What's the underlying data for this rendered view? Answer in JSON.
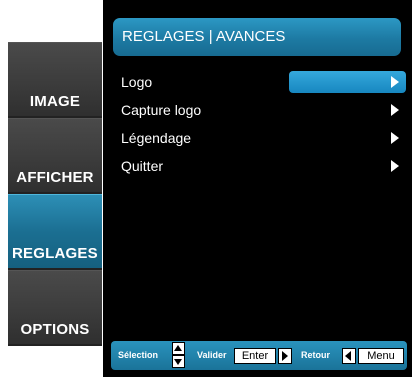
{
  "tabs": [
    {
      "label": "IMAGE",
      "active": false
    },
    {
      "label": "AFFICHER",
      "active": false
    },
    {
      "label": "REGLAGES",
      "active": true
    },
    {
      "label": "OPTIONS",
      "active": false
    }
  ],
  "panel": {
    "title": "REGLAGES | AVANCES",
    "items": [
      {
        "label": "Logo",
        "selected": true
      },
      {
        "label": "Capture logo",
        "selected": false
      },
      {
        "label": "Légendage",
        "selected": false
      },
      {
        "label": "Quitter",
        "selected": false
      }
    ]
  },
  "help_bar": {
    "selection_label": "Sélection",
    "validate_label": "Valider",
    "enter_key": "Enter",
    "back_label": "Retour",
    "menu_key": "Menu"
  },
  "colors": {
    "accent": "#1d7aa3",
    "selection": "#2596cf",
    "panel_background": "#000000",
    "tab_background": "#3c3c3c"
  },
  "icons": [
    "chevron-right-icon",
    "arrow-up-key-icon",
    "arrow-down-key-icon",
    "arrow-left-key-icon"
  ]
}
